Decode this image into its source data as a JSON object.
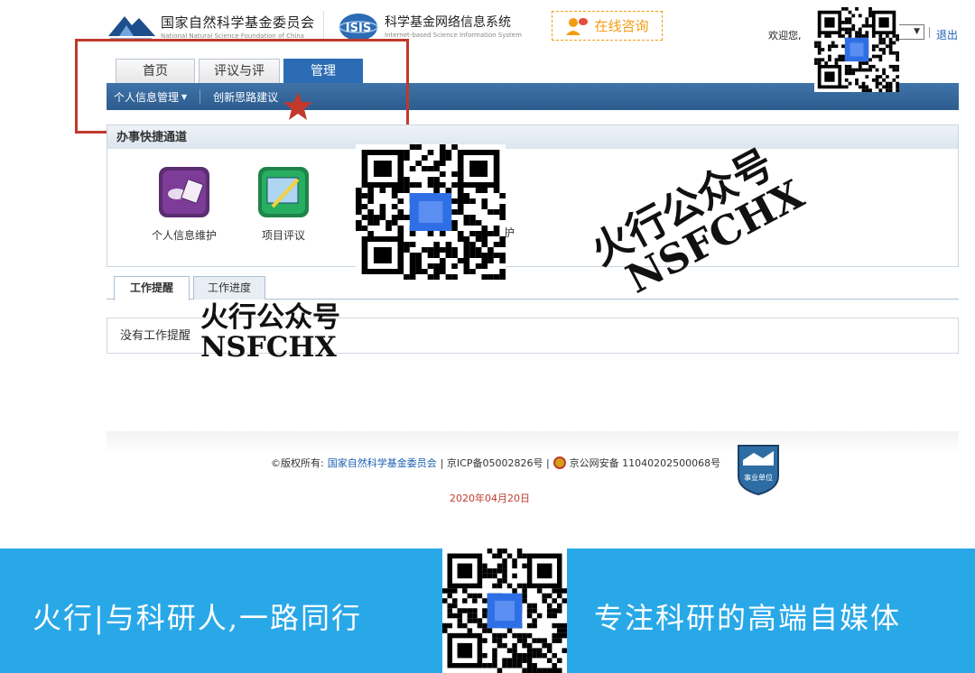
{
  "header": {
    "org_name": "国家自然科学基金委员会",
    "org_en": "National Natural Science Foundation of China",
    "system_name": "科学基金网络信息系统",
    "system_en": "Internet-based Science Information System",
    "consult_label": "在线咨询",
    "welcome": "欢迎您,",
    "logout": "退出"
  },
  "tabs": [
    {
      "label": "首页"
    },
    {
      "label": "评议与评审"
    },
    {
      "label": "管理"
    }
  ],
  "subnav": [
    {
      "label": "个人信息管理"
    },
    {
      "label": "创新思路建议"
    }
  ],
  "shortcuts": {
    "title": "办事快捷通道",
    "items": [
      {
        "label": "个人信息维护"
      },
      {
        "label": "项目评议"
      },
      {
        "label": "护"
      }
    ]
  },
  "work": {
    "tabs": [
      {
        "label": "工作提醒"
      },
      {
        "label": "工作进度"
      }
    ],
    "empty": "没有工作提醒"
  },
  "footer": {
    "copyright_prefix": "©版权所有:",
    "copyright_org": "国家自然科学基金委员会",
    "icp": "| 京ICP备05002826号 |",
    "police": "京公网安备 11040202500068号",
    "badge": "事业单位",
    "date": "2020年04月20日"
  },
  "watermarks": {
    "line1": "火行公众号",
    "line2": "NSFCHX"
  },
  "banner": {
    "left": "火行|与科研人,一路同行",
    "right": "专注科研的高端自媒体"
  },
  "colors": {
    "nav": "#2d5c8e",
    "active_tab": "#2c6cb4",
    "highlight": "#c0392b",
    "consult": "#f39c12",
    "banner": "#29a8e8"
  }
}
